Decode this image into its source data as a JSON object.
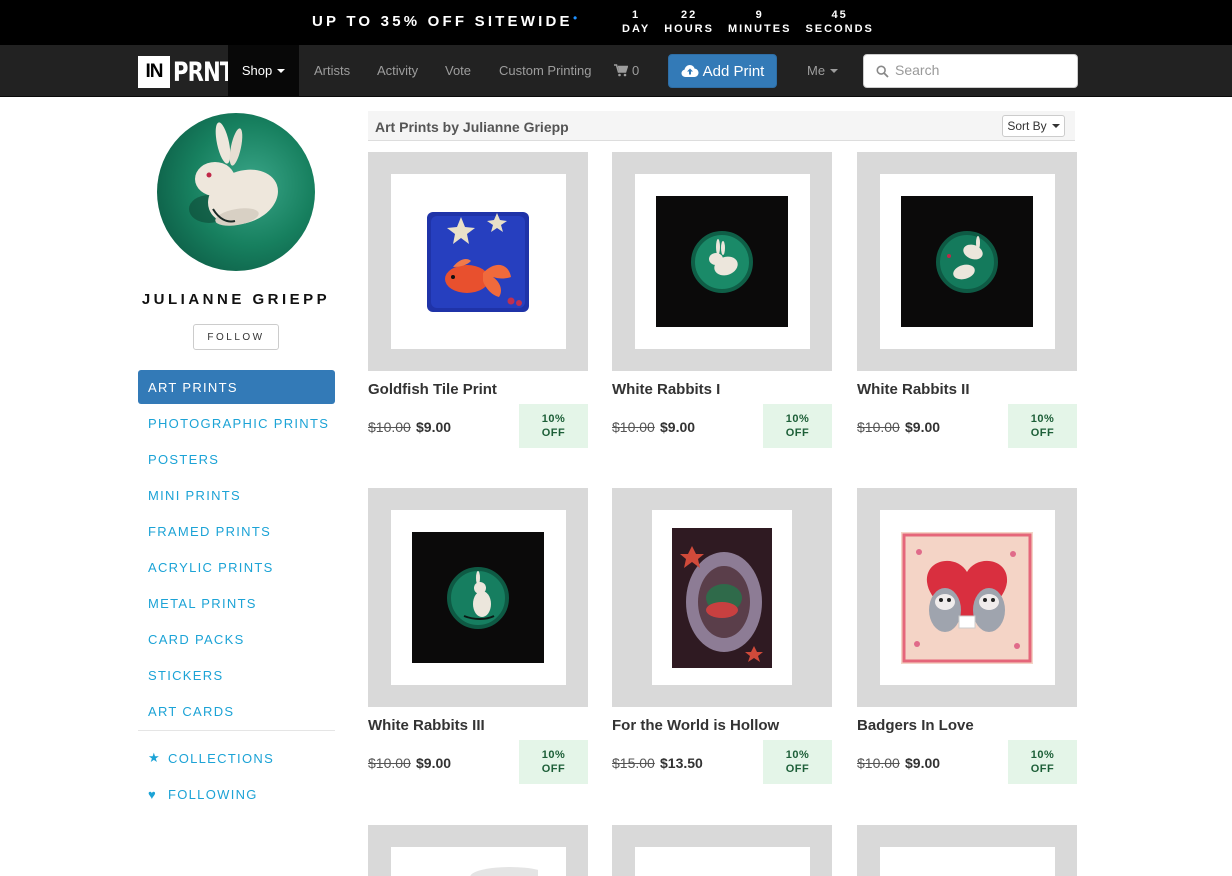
{
  "promo": {
    "text": "UP TO 35% OFF SITEWIDE",
    "countdown": [
      {
        "value": "1",
        "unit": "DAY"
      },
      {
        "value": "22",
        "unit": "HOURS"
      },
      {
        "value": "9",
        "unit": "MINUTES"
      },
      {
        "value": "45",
        "unit": "SECONDS"
      }
    ]
  },
  "nav": {
    "logo_in": "IN",
    "logo_prnt": "PRNT",
    "shop": "Shop",
    "artists": "Artists",
    "activity": "Activity",
    "vote": "Vote",
    "custom_printing": "Custom Printing",
    "cart_count": "0",
    "add_print": "Add Print",
    "me": "Me",
    "search_placeholder": "Search"
  },
  "artist": {
    "name": "JULIANNE GRIEPP",
    "follow_label": "FOLLOW"
  },
  "sidebar": {
    "items": [
      {
        "label": "ART PRINTS",
        "active": true
      },
      {
        "label": "PHOTOGRAPHIC PRINTS"
      },
      {
        "label": "POSTERS"
      },
      {
        "label": "MINI PRINTS"
      },
      {
        "label": "FRAMED PRINTS"
      },
      {
        "label": "ACRYLIC PRINTS"
      },
      {
        "label": "METAL PRINTS"
      },
      {
        "label": "CARD PACKS"
      },
      {
        "label": "STICKERS"
      },
      {
        "label": "ART CARDS"
      }
    ],
    "collections": "COLLECTIONS",
    "following": "FOLLOWING"
  },
  "content": {
    "title": "Art Prints by Julianne Griepp",
    "sort_label": "Sort By"
  },
  "products": [
    {
      "title": "Goldfish Tile Print",
      "old_price": "$10.00",
      "price": "$9.00",
      "badge_pct": "10%",
      "badge_off": "OFF"
    },
    {
      "title": "White Rabbits I",
      "old_price": "$10.00",
      "price": "$9.00",
      "badge_pct": "10%",
      "badge_off": "OFF"
    },
    {
      "title": "White Rabbits II",
      "old_price": "$10.00",
      "price": "$9.00",
      "badge_pct": "10%",
      "badge_off": "OFF"
    },
    {
      "title": "White Rabbits III",
      "old_price": "$10.00",
      "price": "$9.00",
      "badge_pct": "10%",
      "badge_off": "OFF"
    },
    {
      "title": "For the World is Hollow",
      "old_price": "$15.00",
      "price": "$13.50",
      "badge_pct": "10%",
      "badge_off": "OFF"
    },
    {
      "title": "Badgers In Love",
      "old_price": "$10.00",
      "price": "$9.00",
      "badge_pct": "10%",
      "badge_off": "OFF"
    }
  ],
  "colors": {
    "accent": "#337ab7",
    "link": "#1ca3d6",
    "badge_bg": "#e4f5e8",
    "badge_text": "#1d5f38"
  }
}
